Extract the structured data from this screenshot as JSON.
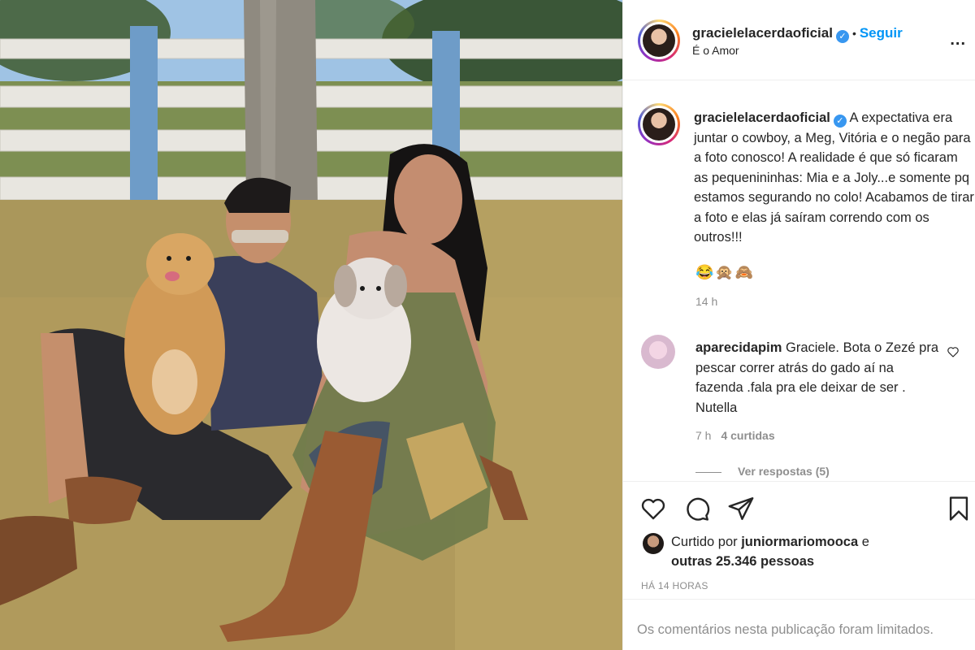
{
  "post": {
    "photo_alt": "Foto do post"
  },
  "header": {
    "username": "gracielelacerdaoficial",
    "separator": "•",
    "follow_label": "Seguir",
    "location": "É o Amor",
    "more_label": "..."
  },
  "caption": {
    "username": "gracielelacerdaoficial",
    "text": "A expectativa era juntar o cowboy, a Meg, Vitória e o negão para a foto conosco! A realidade é que só ficaram as pequenininhas: Mia e a Joly...e somente pq estamos segurando no colo! Acabamos de tirar a foto e elas já saíram correndo com os outros!!!",
    "emojis": "😂🙊🙈",
    "time": "14 h"
  },
  "comments": [
    {
      "username": "aparecidapim",
      "text": "Graciele. Bota o Zezé pra pescar correr atrás do gado aí na fazenda .fala pra ele deixar de ser . Nutella",
      "time": "7 h",
      "likes": "4 curtidas",
      "view_replies": "Ver respostas (5)"
    }
  ],
  "likes": {
    "prefix": "Curtido por",
    "user": "juniormariomooca",
    "suffix": "e",
    "others": "outras 25.346 pessoas"
  },
  "timestamp": "HÁ 14 HORAS",
  "comments_limited": "Os comentários nesta publicação foram limitados.",
  "icons": {
    "like": "heart-icon",
    "comment": "comment-icon",
    "share": "share-icon",
    "save": "bookmark-icon",
    "verified": "verified-badge-icon"
  },
  "colors": {
    "link_blue": "#0095f6",
    "verified_blue": "#3897f0",
    "muted_text": "#8e8e8e",
    "text": "#262626"
  }
}
